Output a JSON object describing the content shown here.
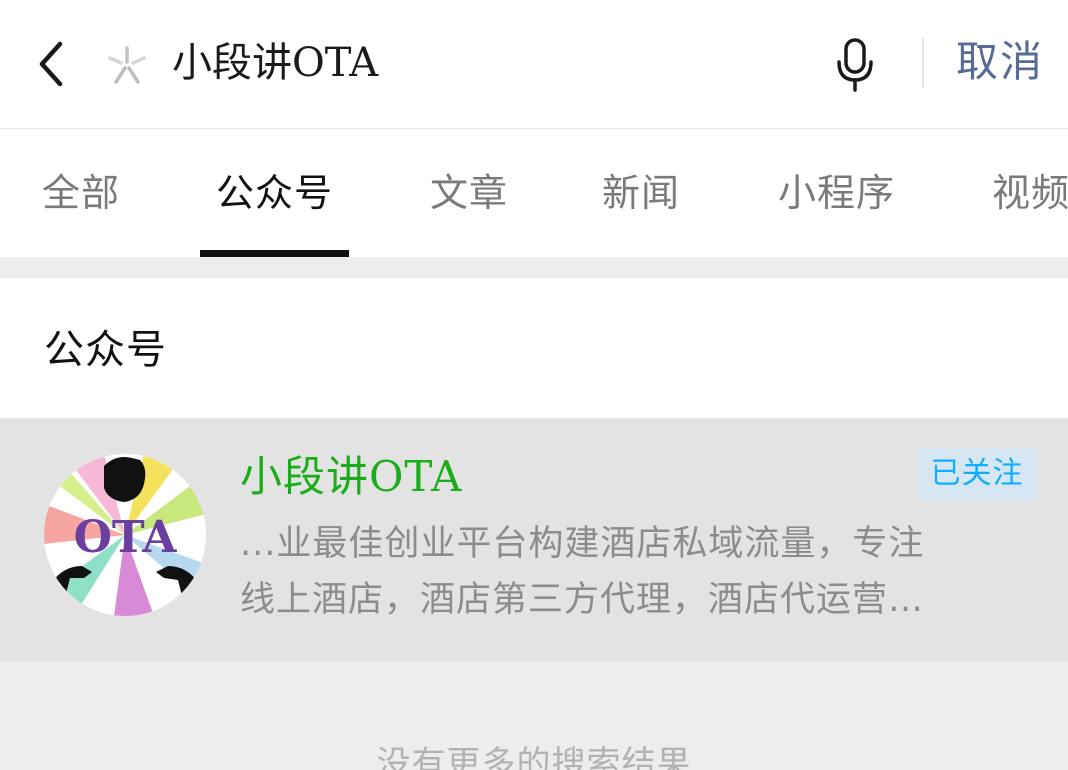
{
  "search": {
    "query": "小段讲OTA",
    "cancel_label": "取消"
  },
  "tabs": [
    {
      "label": "全部",
      "active": false
    },
    {
      "label": "公众号",
      "active": true
    },
    {
      "label": "文章",
      "active": false
    },
    {
      "label": "新闻",
      "active": false
    },
    {
      "label": "小程序",
      "active": false
    },
    {
      "label": "视频",
      "active": false
    }
  ],
  "section": {
    "title": "公众号"
  },
  "result": {
    "name": "小段讲OTA",
    "follow_status": "已关注",
    "description_line1": "...业最佳创业平台构建酒店私域流量，专注",
    "description_line2": "线上酒店，酒店第三方代理，酒店代运营…",
    "avatar_text": "OTA"
  },
  "footer": {
    "no_more_results": "没有更多的搜索结果"
  },
  "colors": {
    "accent_green": "#1aad19",
    "link_blue": "#576b95",
    "badge_text": "#10aeff",
    "badge_bg": "#d6e6f2"
  },
  "icons": {
    "back": "chevron-left-icon",
    "search": "sparkle-search-icon",
    "mic": "microphone-icon"
  }
}
